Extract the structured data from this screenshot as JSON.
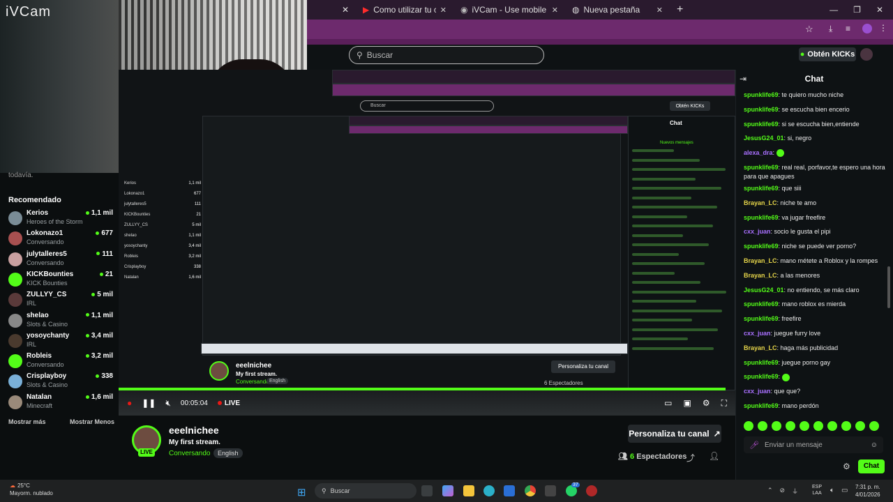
{
  "overlay": {
    "app_label": "iVCam"
  },
  "browser": {
    "tabs": [
      {
        "title": "Como utilizar tu celular como c",
        "icon": "youtube-icon"
      },
      {
        "title": "iVCam - Use mobile phone as",
        "icon": "ivcam-icon"
      },
      {
        "title": "Nueva pestaña",
        "icon": "chrome-icon"
      }
    ],
    "new_tab": "+",
    "minimize": "—",
    "maximize": "❐",
    "close": "✕"
  },
  "kick": {
    "search_placeholder": "Buscar",
    "kicks_button": "Obtén KICKs"
  },
  "sidebar": {
    "truncated_text": "todavía.",
    "title": "Recomendado",
    "items": [
      {
        "name": "Kerios",
        "category": "Heroes of the Storm",
        "viewers": "1,1 mil",
        "color": "#7a8c96"
      },
      {
        "name": "Lokonazo1",
        "category": "Conversando",
        "viewers": "677",
        "color": "#a85050"
      },
      {
        "name": "julytalleres5",
        "category": "Conversando",
        "viewers": "111",
        "color": "#c9a0a0"
      },
      {
        "name": "KICKBounties",
        "category": "KICK Bounties",
        "viewers": "21",
        "color": "#53fc18"
      },
      {
        "name": "ZULLYY_CS",
        "category": "IRL",
        "viewers": "5 mil",
        "color": "#5a3a3a"
      },
      {
        "name": "shelao",
        "category": "Slots & Casino",
        "viewers": "1,1 mil",
        "color": "#888"
      },
      {
        "name": "yosoychanty",
        "category": "IRL",
        "viewers": "3,4 mil",
        "color": "#4a3a2e"
      },
      {
        "name": "Robleis",
        "category": "Conversando",
        "viewers": "3,2 mil",
        "color": "#53fc18"
      },
      {
        "name": "Crisplayboy",
        "category": "Slots & Casino",
        "viewers": "338",
        "color": "#7ab0d8"
      },
      {
        "name": "Natalan",
        "category": "Minecraft",
        "viewers": "1,6 mil",
        "color": "#9a8a7a"
      }
    ],
    "show_more": "Mostrar más",
    "show_less": "Mostrar Menos"
  },
  "player": {
    "time": "00:05:04",
    "live_label": "LIVE"
  },
  "channel": {
    "name": "eeelnichee",
    "title": "My first stream.",
    "category": "Conversando",
    "language": "English",
    "live_badge": "LIVE",
    "customize": "Personaliza tu canal",
    "viewers_count": "6",
    "viewers_label": "Espectadores"
  },
  "chat": {
    "title": "Chat",
    "messages": [
      {
        "user": "spunklife69",
        "color": "#53fc18",
        "text": "te quiero mucho niche"
      },
      {
        "user": "spunklife69",
        "color": "#53fc18",
        "text": "se escucha bien encerio"
      },
      {
        "user": "spunklife69",
        "color": "#53fc18",
        "text": "si se escucha bien,entiende"
      },
      {
        "user": "JesusG24_01",
        "color": "#53fc18",
        "text": "si, negro"
      },
      {
        "user": "alexa_dra",
        "color": "#a970ff",
        "text": ""
      },
      {
        "user": "spunklife69",
        "color": "#53fc18",
        "text": "real real, porfavor,te espero una hora para que apagues"
      },
      {
        "user": "spunklife69",
        "color": "#53fc18",
        "text": "que siii"
      },
      {
        "user": "Brayan_LC",
        "color": "#e6d54a",
        "text": "niche te amo"
      },
      {
        "user": "spunklife69",
        "color": "#53fc18",
        "text": "va jugar freefire"
      },
      {
        "user": "cxx_juan",
        "color": "#a970ff",
        "text": "socio le gusta el pipi"
      },
      {
        "user": "spunklife69",
        "color": "#53fc18",
        "text": "niche se puede ver porno?"
      },
      {
        "user": "Brayan_LC",
        "color": "#e6d54a",
        "text": "mano métete a Roblox y la rompes"
      },
      {
        "user": "Brayan_LC",
        "color": "#e6d54a",
        "text": "a las menores"
      },
      {
        "user": "JesusG24_01",
        "color": "#53fc18",
        "text": "no entiendo, se más claro"
      },
      {
        "user": "spunklife69",
        "color": "#53fc18",
        "text": "mano roblox es mierda"
      },
      {
        "user": "spunklife69",
        "color": "#53fc18",
        "text": "freefire"
      },
      {
        "user": "cxx_juan",
        "color": "#a970ff",
        "text": "juegue furry love"
      },
      {
        "user": "Brayan_LC",
        "color": "#e6d54a",
        "text": "haga más publicidad"
      },
      {
        "user": "spunklife69",
        "color": "#53fc18",
        "text": "juegue porno gay"
      },
      {
        "user": "spunklife69",
        "color": "#53fc18",
        "text": ""
      },
      {
        "user": "cxx_juan",
        "color": "#a970ff",
        "text": "que que?"
      },
      {
        "user": "spunklife69",
        "color": "#53fc18",
        "text": "mano perdón"
      }
    ],
    "input_placeholder": "Enviar un mensaje",
    "send_label": "Chat"
  },
  "nested": {
    "search": "Buscar",
    "kicks": "Obtén KICKs",
    "chat_title": "Chat",
    "streamer": "eeelnichee",
    "customize": "Personaliza tu canal",
    "viewers": "6 Espectadores",
    "new_messages": "Nuevos mensajes",
    "sidebar_items": [
      {
        "name": "Kerios",
        "v": "1,1 mil"
      },
      {
        "name": "Lokonazo1",
        "v": "677"
      },
      {
        "name": "julytalleres5",
        "v": "111"
      },
      {
        "name": "KICKBounties",
        "v": "21"
      },
      {
        "name": "ZULLYY_CS",
        "v": "5 mil"
      },
      {
        "name": "shelao",
        "v": "1,1 mil"
      },
      {
        "name": "yosoychanty",
        "v": "3,4 mil"
      },
      {
        "name": "Robleis",
        "v": "3,2 mil"
      },
      {
        "name": "Crisplayboy",
        "v": "338"
      },
      {
        "name": "Natalan",
        "v": "1,6 mil"
      }
    ]
  },
  "taskbar": {
    "weather_temp": "25°C",
    "weather_desc": "Mayorm. nublado",
    "search": "Buscar",
    "lang_top": "ESP",
    "lang_bottom": "LAA",
    "time": "7:31 p. m.",
    "date": "4/01/2026",
    "badge": "37"
  }
}
